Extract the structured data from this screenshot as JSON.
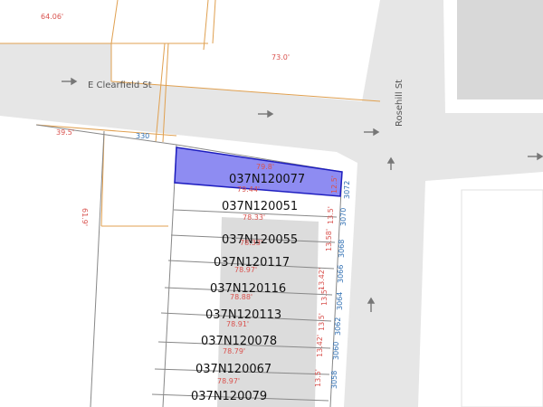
{
  "map": {
    "streets": {
      "clearfield": "E Clearfield St",
      "rosehill": "Rosehill St"
    },
    "selected_parcel": {
      "id": "037N120077",
      "dim_top": "79.8'",
      "dim_bottom": "79.44'",
      "dim_side": "12.5'",
      "highlight_color": "#5b5bea"
    },
    "parcels": [
      {
        "id": "037N120051",
        "depth": "78.33'",
        "frontage": "13.5'",
        "address": "3070"
      },
      {
        "id": "037N120055",
        "depth": "78.33'",
        "frontage": "13.58'",
        "address": "3068"
      },
      {
        "id": "037N120117",
        "depth": "78.97'",
        "frontage": "",
        "address": "3066"
      },
      {
        "id": "037N120116",
        "depth": "78.88'",
        "frontage": "13.5'",
        "address": "3064"
      },
      {
        "id": "037N120113",
        "depth": "78.91'",
        "frontage": "13.5'",
        "address": "3062"
      },
      {
        "id": "037N120078",
        "depth": "78.79'",
        "frontage": "13.42'",
        "address": "3060"
      },
      {
        "id": "037N120067",
        "depth": "78.97'",
        "frontage": "13.5'",
        "address": "3058"
      },
      {
        "id": "037N120079",
        "depth": "",
        "frontage": "",
        "address": ""
      }
    ],
    "other_labels": {
      "addr_corner": "330",
      "addr_3072": "3072",
      "dim_64": "64.06'",
      "dim_73": "73.0'",
      "dim_39": "39.5'",
      "dim_61": "61.9'",
      "dim_13_42": "13.42'"
    }
  }
}
